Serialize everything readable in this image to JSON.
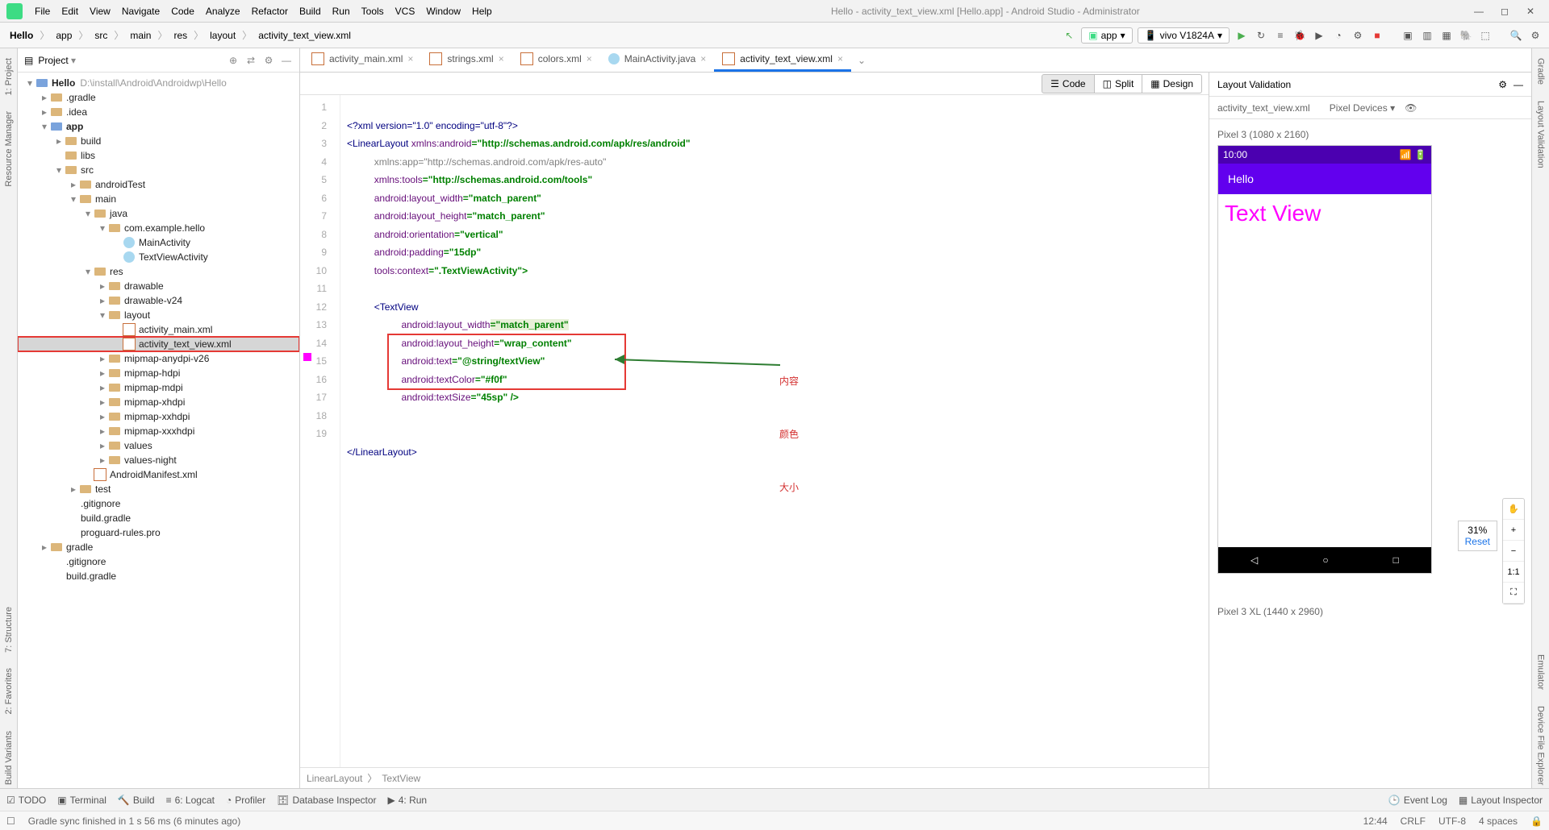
{
  "window": {
    "title": "Hello - activity_text_view.xml [Hello.app] - Android Studio - Administrator"
  },
  "menu": [
    "File",
    "Edit",
    "View",
    "Navigate",
    "Code",
    "Analyze",
    "Refactor",
    "Build",
    "Run",
    "Tools",
    "VCS",
    "Window",
    "Help"
  ],
  "breadcrumb": [
    "Hello",
    "app",
    "src",
    "main",
    "res",
    "layout",
    "activity_text_view.xml"
  ],
  "toolbar": {
    "app_selector": "app",
    "device_selector": "vivo V1824A",
    "device_chevron": "▾"
  },
  "left_tabs": [
    "1: Project",
    "Resource Manager",
    "7: Structure",
    "2: Favorites",
    "Build Variants"
  ],
  "right_tabs": [
    "Gradle",
    "Layout Validation",
    "Emulator",
    "Device File Explorer"
  ],
  "project": {
    "header": "Project",
    "nodes": [
      {
        "d": 0,
        "a": "▾",
        "t": "fold mod",
        "l": "Hello",
        "p": "D:\\install\\Android\\Androidwp\\Hello"
      },
      {
        "d": 1,
        "a": "▸",
        "t": "fold",
        "l": ".gradle"
      },
      {
        "d": 1,
        "a": "▸",
        "t": "fold",
        "l": ".idea"
      },
      {
        "d": 1,
        "a": "▾",
        "t": "fold mod",
        "l": "app"
      },
      {
        "d": 2,
        "a": "▸",
        "t": "fold",
        "l": "build"
      },
      {
        "d": 2,
        "a": "",
        "t": "fold",
        "l": "libs"
      },
      {
        "d": 2,
        "a": "▾",
        "t": "fold",
        "l": "src"
      },
      {
        "d": 3,
        "a": "▸",
        "t": "fold",
        "l": "androidTest"
      },
      {
        "d": 3,
        "a": "▾",
        "t": "fold",
        "l": "main"
      },
      {
        "d": 4,
        "a": "▾",
        "t": "fold",
        "l": "java"
      },
      {
        "d": 5,
        "a": "▾",
        "t": "fold",
        "l": "com.example.hello"
      },
      {
        "d": 6,
        "a": "",
        "t": "java",
        "l": "MainActivity"
      },
      {
        "d": 6,
        "a": "",
        "t": "java",
        "l": "TextViewActivity"
      },
      {
        "d": 4,
        "a": "▾",
        "t": "fold",
        "l": "res"
      },
      {
        "d": 5,
        "a": "▸",
        "t": "fold",
        "l": "drawable"
      },
      {
        "d": 5,
        "a": "▸",
        "t": "fold",
        "l": "drawable-v24"
      },
      {
        "d": 5,
        "a": "▾",
        "t": "fold",
        "l": "layout"
      },
      {
        "d": 6,
        "a": "",
        "t": "xml",
        "l": "activity_main.xml"
      },
      {
        "d": 6,
        "a": "",
        "t": "xml",
        "l": "activity_text_view.xml",
        "sel": true,
        "hl": true
      },
      {
        "d": 5,
        "a": "▸",
        "t": "fold",
        "l": "mipmap-anydpi-v26"
      },
      {
        "d": 5,
        "a": "▸",
        "t": "fold",
        "l": "mipmap-hdpi"
      },
      {
        "d": 5,
        "a": "▸",
        "t": "fold",
        "l": "mipmap-mdpi"
      },
      {
        "d": 5,
        "a": "▸",
        "t": "fold",
        "l": "mipmap-xhdpi"
      },
      {
        "d": 5,
        "a": "▸",
        "t": "fold",
        "l": "mipmap-xxhdpi"
      },
      {
        "d": 5,
        "a": "▸",
        "t": "fold",
        "l": "mipmap-xxxhdpi"
      },
      {
        "d": 5,
        "a": "▸",
        "t": "fold",
        "l": "values"
      },
      {
        "d": 5,
        "a": "▸",
        "t": "fold",
        "l": "values-night"
      },
      {
        "d": 4,
        "a": "",
        "t": "xml",
        "l": "AndroidManifest.xml"
      },
      {
        "d": 3,
        "a": "▸",
        "t": "fold",
        "l": "test"
      },
      {
        "d": 2,
        "a": "",
        "t": "file",
        "l": ".gitignore"
      },
      {
        "d": 2,
        "a": "",
        "t": "file",
        "l": "build.gradle"
      },
      {
        "d": 2,
        "a": "",
        "t": "file",
        "l": "proguard-rules.pro"
      },
      {
        "d": 1,
        "a": "▸",
        "t": "fold",
        "l": "gradle"
      },
      {
        "d": 1,
        "a": "",
        "t": "file",
        "l": ".gitignore"
      },
      {
        "d": 1,
        "a": "",
        "t": "file",
        "l": "build.gradle"
      }
    ]
  },
  "tabs": [
    {
      "l": "activity_main.xml",
      "ico": "xml"
    },
    {
      "l": "strings.xml",
      "ico": "xml"
    },
    {
      "l": "colors.xml",
      "ico": "xml"
    },
    {
      "l": "MainActivity.java",
      "ico": "java"
    },
    {
      "l": "activity_text_view.xml",
      "ico": "xml",
      "active": true
    }
  ],
  "modes": {
    "code": "Code",
    "split": "Split",
    "design": "Design"
  },
  "code_lines": 19,
  "code": {
    "l1": "<?xml version=\"1.0\" encoding=\"utf-8\"?>",
    "l2a": "<LinearLayout ",
    "l2b": "xmlns:android",
    "l2c": "=\"http://schemas.android.com/apk/res/android\"",
    "l3a": "xmlns:app",
    "l3b": "=\"http://schemas.android.com/apk/res-auto\"",
    "l4a": "xmlns:tools",
    "l4b": "=\"http://schemas.android.com/tools\"",
    "l5a": "android:layout_width",
    "l5b": "=\"match_parent\"",
    "l6a": "android:layout_height",
    "l6b": "=\"match_parent\"",
    "l7a": "android:orientation",
    "l7b": "=\"vertical\"",
    "l8a": "android:padding",
    "l8b": "=\"15dp\"",
    "l9a": "tools:context",
    "l9b": "=\".TextViewActivity\">",
    "l11": "<TextView",
    "l12a": "android:layout_width",
    "l12b": "=\"match_parent\"",
    "l13a": "android:layout_height",
    "l13b": "=\"wrap_content\"",
    "l14a": "android:text",
    "l14b": "=\"@string/textView\"",
    "l15a": "android:textColor",
    "l15b": "=\"#f0f\"",
    "l16a": "android:textSize",
    "l16b": "=\"45sp\" />",
    "l19": "</LinearLayout>"
  },
  "annotations": {
    "content": "内容",
    "color": "颜色",
    "size": "大小"
  },
  "editor_crumbs": [
    "LinearLayout",
    "TextView"
  ],
  "layout_panel": {
    "title": "Layout Validation",
    "file": "activity_text_view.xml",
    "device_dropdown": "Pixel Devices",
    "device1": "Pixel 3 (1080 x 2160)",
    "device2": "Pixel 3 XL (1440 x 2960)",
    "time": "10:00",
    "app_title": "Hello",
    "textview": "Text View",
    "zoom": "31%",
    "reset": "Reset"
  },
  "bottom": {
    "todo": "TODO",
    "terminal": "Terminal",
    "build": "Build",
    "logcat": "6: Logcat",
    "profiler": "Profiler",
    "db": "Database Inspector",
    "run": "4: Run",
    "eventlog": "Event Log",
    "layoutinsp": "Layout Inspector"
  },
  "status": {
    "msg": "Gradle sync finished in 1 s 56 ms (6 minutes ago)",
    "pos": "12:44",
    "eol": "CRLF",
    "enc": "UTF-8",
    "indent": "4 spaces"
  }
}
